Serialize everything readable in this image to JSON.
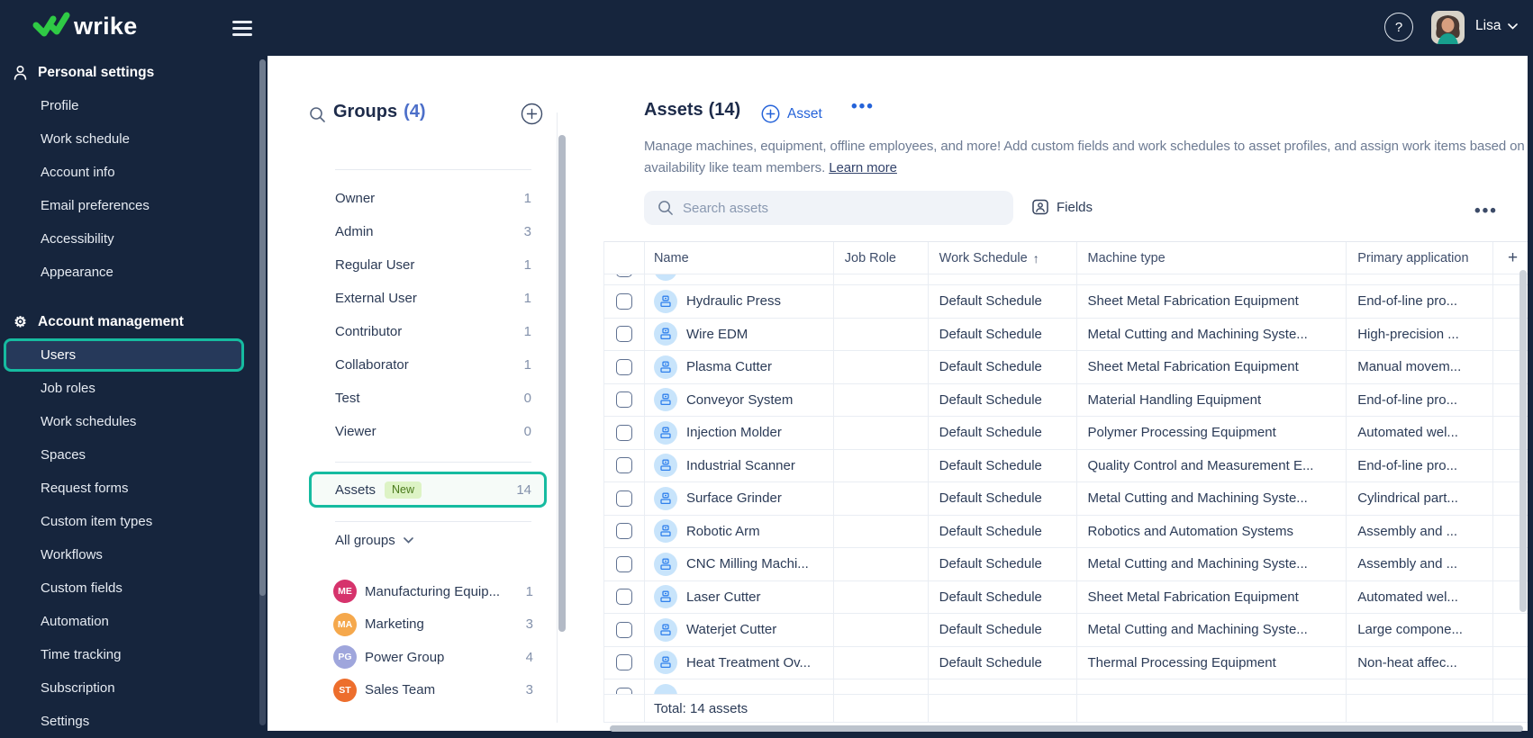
{
  "colors": {
    "topbar_bg": "#16253d",
    "teal_highlight": "#16bba0",
    "accent_blue": "#2563d9",
    "logo_green": "#2fca45",
    "badge_bg": "#ddf3c5",
    "badge_text": "#4a7a1c",
    "asset_icon_bg": "#c8e4fb",
    "asset_icon_glyph": "#2f80ec"
  },
  "icons": {
    "help": "?",
    "sort_asc": "↑",
    "more": "•••",
    "add_column": "+"
  },
  "topbar": {
    "logo_text": "wrike",
    "user_name": "Lisa"
  },
  "sidebar": {
    "sections": [
      {
        "title": "Personal settings",
        "icon": "person-icon",
        "items": [
          {
            "label": "Profile"
          },
          {
            "label": "Work schedule"
          },
          {
            "label": "Account info"
          },
          {
            "label": "Email preferences"
          },
          {
            "label": "Accessibility"
          },
          {
            "label": "Appearance"
          }
        ]
      },
      {
        "title": "Account management",
        "icon": "gear-icon",
        "items": [
          {
            "label": "Users",
            "selected": true
          },
          {
            "label": "Job roles"
          },
          {
            "label": "Work schedules"
          },
          {
            "label": "Spaces"
          },
          {
            "label": "Request forms"
          },
          {
            "label": "Custom item types"
          },
          {
            "label": "Workflows"
          },
          {
            "label": "Custom fields"
          },
          {
            "label": "Automation"
          },
          {
            "label": "Time tracking"
          },
          {
            "label": "Subscription"
          },
          {
            "label": "Settings"
          }
        ]
      }
    ]
  },
  "groups_panel": {
    "title": "Groups",
    "count": "(4)",
    "roles": [
      {
        "label": "Owner",
        "count": 1
      },
      {
        "label": "Admin",
        "count": 3
      },
      {
        "label": "Regular User",
        "count": 1
      },
      {
        "label": "External User",
        "count": 1
      },
      {
        "label": "Contributor",
        "count": 1
      },
      {
        "label": "Collaborator",
        "count": 1
      },
      {
        "label": "Test",
        "count": 0
      },
      {
        "label": "Viewer",
        "count": 0
      }
    ],
    "assets_row": {
      "label": "Assets",
      "badge": "New",
      "count": 14
    },
    "filter_label": "All groups",
    "groups": [
      {
        "initials": "ME",
        "label": "Manufacturing Equip...",
        "count": 1,
        "color": "#d6336c"
      },
      {
        "initials": "MA",
        "label": "Marketing",
        "count": 3,
        "color": "#f5a84c"
      },
      {
        "initials": "PG",
        "label": "Power Group",
        "count": 4,
        "color": "#9fa6dc"
      },
      {
        "initials": "ST",
        "label": "Sales Team",
        "count": 3,
        "color": "#ed6e2d"
      }
    ]
  },
  "main": {
    "title": "Assets",
    "count": "(14)",
    "add_button": "Asset",
    "description_line1": "Manage machines, equipment, offline employees, and more! Add custom fields and work schedules to asset profiles, and assign work items based on",
    "description_line2": "availability like team members.",
    "learn_more": "Learn more",
    "search_placeholder": "Search assets",
    "fields_button": "Fields",
    "table": {
      "columns": [
        "Name",
        "Job Role",
        "Work Schedule",
        "Machine type",
        "Primary application"
      ],
      "sort_column": "Work Schedule",
      "rows": [
        {
          "name": "Hydraulic Press",
          "job_role": "",
          "work_schedule": "Default Schedule",
          "machine_type": "Sheet Metal Fabrication Equipment",
          "primary_application": "End-of-line pro..."
        },
        {
          "name": "Wire EDM",
          "job_role": "",
          "work_schedule": "Default Schedule",
          "machine_type": "Metal Cutting and Machining Syste...",
          "primary_application": "High-precision ..."
        },
        {
          "name": "Plasma Cutter",
          "job_role": "",
          "work_schedule": "Default Schedule",
          "machine_type": "Sheet Metal Fabrication Equipment",
          "primary_application": "Manual movem..."
        },
        {
          "name": "Conveyor System",
          "job_role": "",
          "work_schedule": "Default Schedule",
          "machine_type": "Material Handling Equipment",
          "primary_application": "End-of-line pro..."
        },
        {
          "name": "Injection Molder",
          "job_role": "",
          "work_schedule": "Default Schedule",
          "machine_type": "Polymer Processing Equipment",
          "primary_application": "Automated wel..."
        },
        {
          "name": "Industrial Scanner",
          "job_role": "",
          "work_schedule": "Default Schedule",
          "machine_type": "Quality Control and Measurement E...",
          "primary_application": "End-of-line pro..."
        },
        {
          "name": "Surface Grinder",
          "job_role": "",
          "work_schedule": "Default Schedule",
          "machine_type": "Metal Cutting and Machining Syste...",
          "primary_application": "Cylindrical part..."
        },
        {
          "name": "Robotic Arm",
          "job_role": "",
          "work_schedule": "Default Schedule",
          "machine_type": "Robotics and Automation Systems",
          "primary_application": "Assembly and ..."
        },
        {
          "name": "CNC Milling Machi...",
          "job_role": "",
          "work_schedule": "Default Schedule",
          "machine_type": "Metal Cutting and Machining Syste...",
          "primary_application": "Assembly and ..."
        },
        {
          "name": "Laser Cutter",
          "job_role": "",
          "work_schedule": "Default Schedule",
          "machine_type": "Sheet Metal Fabrication Equipment",
          "primary_application": "Automated wel..."
        },
        {
          "name": "Waterjet Cutter",
          "job_role": "",
          "work_schedule": "Default Schedule",
          "machine_type": "Metal Cutting and Machining Syste...",
          "primary_application": "Large compone..."
        },
        {
          "name": "Heat Treatment Ov...",
          "job_role": "",
          "work_schedule": "Default Schedule",
          "machine_type": "Thermal Processing Equipment",
          "primary_application": "Non-heat affec..."
        }
      ],
      "total_label": "Total: 14 assets"
    }
  }
}
